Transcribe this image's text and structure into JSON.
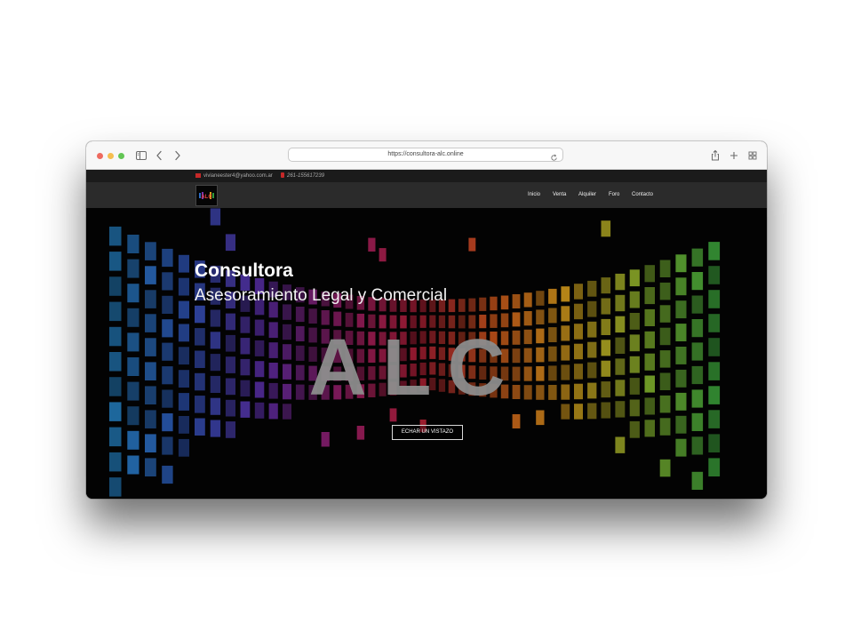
{
  "browser": {
    "url": "https://consultora-alc.online",
    "icons": [
      "sidebar-icon",
      "back-icon",
      "forward-icon",
      "reload-icon",
      "share-icon",
      "new-tab-icon",
      "tab-overview-icon"
    ]
  },
  "topbar": {
    "email": "vivianeester4@yahoo.com.ar",
    "phone": "261-155617239"
  },
  "nav": {
    "logo_text": "ALC",
    "items": [
      "Inicio",
      "Venta",
      "Alquiler",
      "Foro",
      "Contacto"
    ]
  },
  "hero": {
    "title": "Consultora",
    "subtitle": "Asesoramiento Legal y Comercial",
    "big_text": "ALC",
    "cta_label": "ECHAR UN VISTAZO"
  },
  "colors": {
    "top_bar_bg": "#1b1b1b",
    "navbar_bg": "#2b2b2b",
    "hero_bg": "#030303",
    "accent_red": "#c62828",
    "tile_gradient": [
      "#1f6fa8",
      "#2b4aa6",
      "#5a2aa0",
      "#a01f6e",
      "#c0203a",
      "#d65a1c",
      "#d8a21c",
      "#7ba82a",
      "#2f9a3a"
    ]
  }
}
